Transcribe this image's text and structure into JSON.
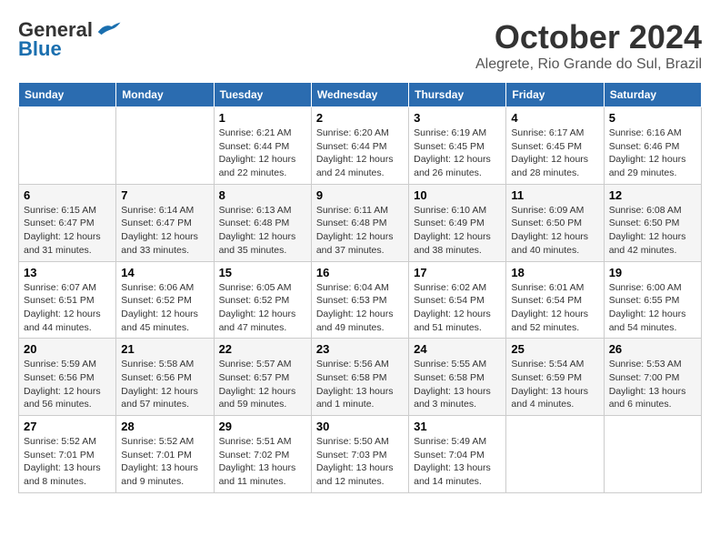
{
  "header": {
    "logo_line1": "General",
    "logo_line2": "Blue",
    "month": "October 2024",
    "location": "Alegrete, Rio Grande do Sul, Brazil"
  },
  "columns": [
    "Sunday",
    "Monday",
    "Tuesday",
    "Wednesday",
    "Thursday",
    "Friday",
    "Saturday"
  ],
  "weeks": [
    [
      {
        "day": "",
        "sunrise": "",
        "sunset": "",
        "daylight": ""
      },
      {
        "day": "",
        "sunrise": "",
        "sunset": "",
        "daylight": ""
      },
      {
        "day": "1",
        "sunrise": "Sunrise: 6:21 AM",
        "sunset": "Sunset: 6:44 PM",
        "daylight": "Daylight: 12 hours and 22 minutes."
      },
      {
        "day": "2",
        "sunrise": "Sunrise: 6:20 AM",
        "sunset": "Sunset: 6:44 PM",
        "daylight": "Daylight: 12 hours and 24 minutes."
      },
      {
        "day": "3",
        "sunrise": "Sunrise: 6:19 AM",
        "sunset": "Sunset: 6:45 PM",
        "daylight": "Daylight: 12 hours and 26 minutes."
      },
      {
        "day": "4",
        "sunrise": "Sunrise: 6:17 AM",
        "sunset": "Sunset: 6:45 PM",
        "daylight": "Daylight: 12 hours and 28 minutes."
      },
      {
        "day": "5",
        "sunrise": "Sunrise: 6:16 AM",
        "sunset": "Sunset: 6:46 PM",
        "daylight": "Daylight: 12 hours and 29 minutes."
      }
    ],
    [
      {
        "day": "6",
        "sunrise": "Sunrise: 6:15 AM",
        "sunset": "Sunset: 6:47 PM",
        "daylight": "Daylight: 12 hours and 31 minutes."
      },
      {
        "day": "7",
        "sunrise": "Sunrise: 6:14 AM",
        "sunset": "Sunset: 6:47 PM",
        "daylight": "Daylight: 12 hours and 33 minutes."
      },
      {
        "day": "8",
        "sunrise": "Sunrise: 6:13 AM",
        "sunset": "Sunset: 6:48 PM",
        "daylight": "Daylight: 12 hours and 35 minutes."
      },
      {
        "day": "9",
        "sunrise": "Sunrise: 6:11 AM",
        "sunset": "Sunset: 6:48 PM",
        "daylight": "Daylight: 12 hours and 37 minutes."
      },
      {
        "day": "10",
        "sunrise": "Sunrise: 6:10 AM",
        "sunset": "Sunset: 6:49 PM",
        "daylight": "Daylight: 12 hours and 38 minutes."
      },
      {
        "day": "11",
        "sunrise": "Sunrise: 6:09 AM",
        "sunset": "Sunset: 6:50 PM",
        "daylight": "Daylight: 12 hours and 40 minutes."
      },
      {
        "day": "12",
        "sunrise": "Sunrise: 6:08 AM",
        "sunset": "Sunset: 6:50 PM",
        "daylight": "Daylight: 12 hours and 42 minutes."
      }
    ],
    [
      {
        "day": "13",
        "sunrise": "Sunrise: 6:07 AM",
        "sunset": "Sunset: 6:51 PM",
        "daylight": "Daylight: 12 hours and 44 minutes."
      },
      {
        "day": "14",
        "sunrise": "Sunrise: 6:06 AM",
        "sunset": "Sunset: 6:52 PM",
        "daylight": "Daylight: 12 hours and 45 minutes."
      },
      {
        "day": "15",
        "sunrise": "Sunrise: 6:05 AM",
        "sunset": "Sunset: 6:52 PM",
        "daylight": "Daylight: 12 hours and 47 minutes."
      },
      {
        "day": "16",
        "sunrise": "Sunrise: 6:04 AM",
        "sunset": "Sunset: 6:53 PM",
        "daylight": "Daylight: 12 hours and 49 minutes."
      },
      {
        "day": "17",
        "sunrise": "Sunrise: 6:02 AM",
        "sunset": "Sunset: 6:54 PM",
        "daylight": "Daylight: 12 hours and 51 minutes."
      },
      {
        "day": "18",
        "sunrise": "Sunrise: 6:01 AM",
        "sunset": "Sunset: 6:54 PM",
        "daylight": "Daylight: 12 hours and 52 minutes."
      },
      {
        "day": "19",
        "sunrise": "Sunrise: 6:00 AM",
        "sunset": "Sunset: 6:55 PM",
        "daylight": "Daylight: 12 hours and 54 minutes."
      }
    ],
    [
      {
        "day": "20",
        "sunrise": "Sunrise: 5:59 AM",
        "sunset": "Sunset: 6:56 PM",
        "daylight": "Daylight: 12 hours and 56 minutes."
      },
      {
        "day": "21",
        "sunrise": "Sunrise: 5:58 AM",
        "sunset": "Sunset: 6:56 PM",
        "daylight": "Daylight: 12 hours and 57 minutes."
      },
      {
        "day": "22",
        "sunrise": "Sunrise: 5:57 AM",
        "sunset": "Sunset: 6:57 PM",
        "daylight": "Daylight: 12 hours and 59 minutes."
      },
      {
        "day": "23",
        "sunrise": "Sunrise: 5:56 AM",
        "sunset": "Sunset: 6:58 PM",
        "daylight": "Daylight: 13 hours and 1 minute."
      },
      {
        "day": "24",
        "sunrise": "Sunrise: 5:55 AM",
        "sunset": "Sunset: 6:58 PM",
        "daylight": "Daylight: 13 hours and 3 minutes."
      },
      {
        "day": "25",
        "sunrise": "Sunrise: 5:54 AM",
        "sunset": "Sunset: 6:59 PM",
        "daylight": "Daylight: 13 hours and 4 minutes."
      },
      {
        "day": "26",
        "sunrise": "Sunrise: 5:53 AM",
        "sunset": "Sunset: 7:00 PM",
        "daylight": "Daylight: 13 hours and 6 minutes."
      }
    ],
    [
      {
        "day": "27",
        "sunrise": "Sunrise: 5:52 AM",
        "sunset": "Sunset: 7:01 PM",
        "daylight": "Daylight: 13 hours and 8 minutes."
      },
      {
        "day": "28",
        "sunrise": "Sunrise: 5:52 AM",
        "sunset": "Sunset: 7:01 PM",
        "daylight": "Daylight: 13 hours and 9 minutes."
      },
      {
        "day": "29",
        "sunrise": "Sunrise: 5:51 AM",
        "sunset": "Sunset: 7:02 PM",
        "daylight": "Daylight: 13 hours and 11 minutes."
      },
      {
        "day": "30",
        "sunrise": "Sunrise: 5:50 AM",
        "sunset": "Sunset: 7:03 PM",
        "daylight": "Daylight: 13 hours and 12 minutes."
      },
      {
        "day": "31",
        "sunrise": "Sunrise: 5:49 AM",
        "sunset": "Sunset: 7:04 PM",
        "daylight": "Daylight: 13 hours and 14 minutes."
      },
      {
        "day": "",
        "sunrise": "",
        "sunset": "",
        "daylight": ""
      },
      {
        "day": "",
        "sunrise": "",
        "sunset": "",
        "daylight": ""
      }
    ]
  ]
}
